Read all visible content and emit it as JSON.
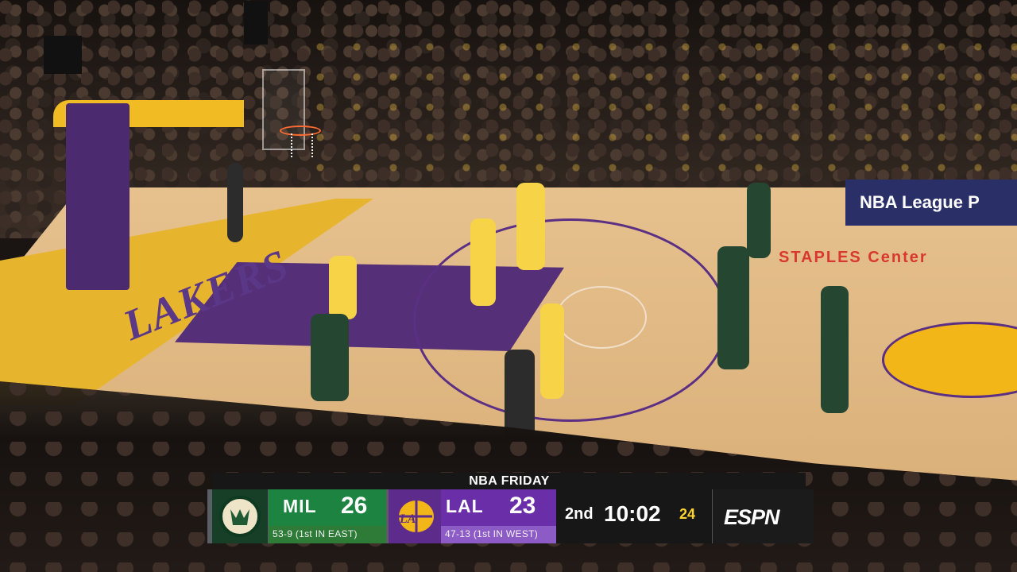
{
  "broadcast": {
    "show_title": "NBA FRIDAY",
    "network": "ESPN"
  },
  "teams": {
    "home_away": [
      {
        "abbr": "MIL",
        "score": "26",
        "record": "53-9 (1st IN EAST)",
        "color": "#1d8341",
        "logo_icon": "bucks-logo-icon"
      },
      {
        "abbr": "LAL",
        "score": "23",
        "record": "47-13 (1st IN WEST)",
        "color": "#6a2ea8",
        "logo_icon": "lakers-logo-icon"
      }
    ]
  },
  "game": {
    "period": "2nd",
    "clock": "10:02",
    "shot_clock": "24"
  },
  "arena_text": {
    "court_brand": "LAKERS",
    "venue": "STAPLES Center",
    "ad": "NBA League P"
  }
}
